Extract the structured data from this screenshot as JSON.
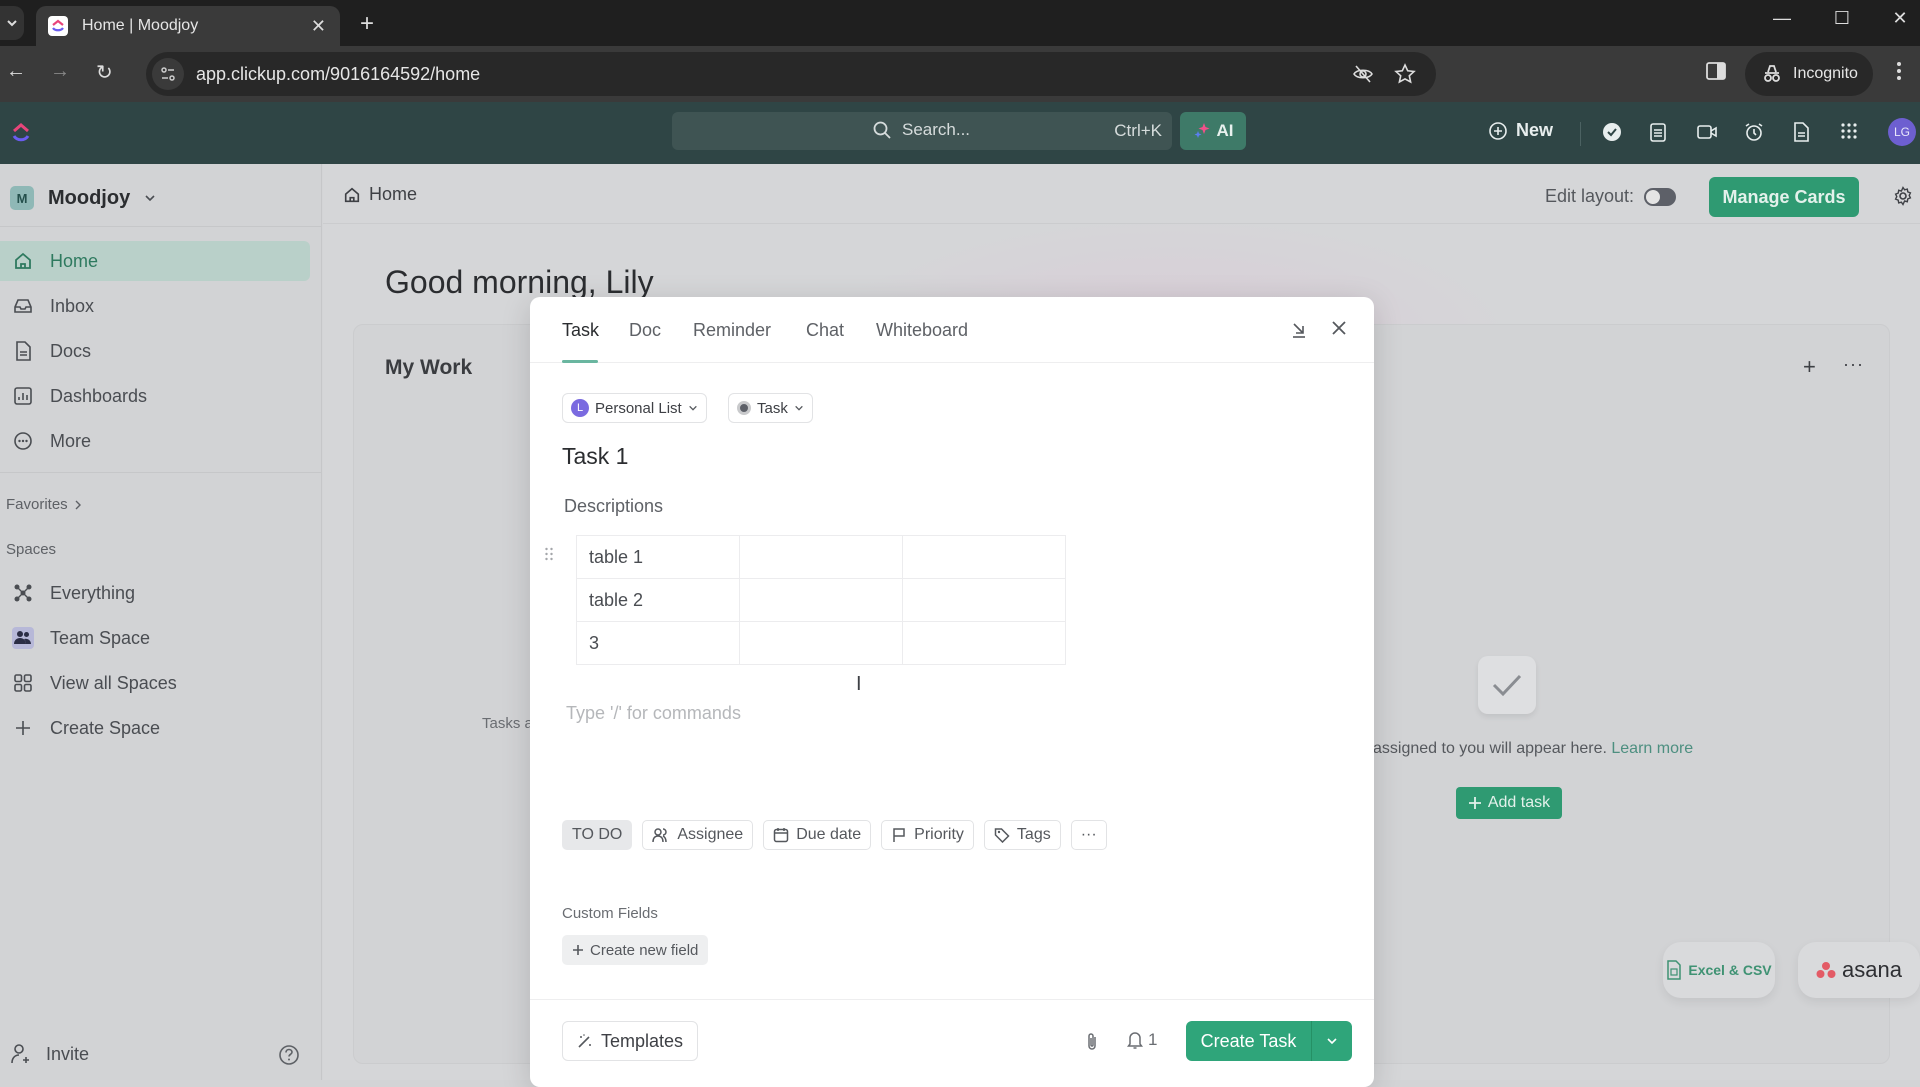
{
  "browser": {
    "tab_title": "Home | Moodjoy",
    "url": "app.clickup.com/9016164592/home",
    "incognito_label": "Incognito"
  },
  "appbar": {
    "search_placeholder": "Search...",
    "search_shortcut": "Ctrl+K",
    "ai_label": "AI",
    "new_label": "New",
    "avatar_initials": "LG"
  },
  "sidebar": {
    "workspace_initial": "M",
    "workspace_name": "Moodjoy",
    "nav": [
      {
        "label": "Home",
        "icon": "home-icon",
        "active": true
      },
      {
        "label": "Inbox",
        "icon": "inbox-icon"
      },
      {
        "label": "Docs",
        "icon": "docs-icon"
      },
      {
        "label": "Dashboards",
        "icon": "dashboards-icon"
      },
      {
        "label": "More",
        "icon": "more-icon"
      }
    ],
    "favorites_label": "Favorites",
    "spaces_label": "Spaces",
    "spaces": [
      {
        "label": "Everything",
        "icon": "everything-icon"
      },
      {
        "label": "Team Space",
        "icon": "team-space-icon"
      },
      {
        "label": "View all Spaces",
        "icon": "grid-icon"
      },
      {
        "label": "Create Space",
        "icon": "plus-icon"
      }
    ],
    "invite_label": "Invite"
  },
  "main": {
    "breadcrumb": "Home",
    "edit_layout_label": "Edit layout:",
    "edit_layout_on": false,
    "manage_cards_label": "Manage Cards",
    "greeting": "Good morning, Lily",
    "my_work_title": "My Work",
    "tasks_partial_text": "Tasks a",
    "empty_text": "assigned to you will appear here.",
    "learn_more": "Learn more",
    "add_task_label": "Add task",
    "import_excel_label": "Excel & CSV",
    "import_asana_label": "asana"
  },
  "modal": {
    "tabs": [
      "Task",
      "Doc",
      "Reminder",
      "Chat",
      "Whiteboard"
    ],
    "active_tab": "Task",
    "list_selector": "Personal List",
    "list_initial": "L",
    "type_selector": "Task",
    "task_name": "Task 1",
    "description_label": "Descriptions",
    "table_rows": [
      [
        "table 1",
        "",
        ""
      ],
      [
        "table 2",
        "",
        ""
      ],
      [
        "3",
        "",
        ""
      ]
    ],
    "command_placeholder": "Type '/' for commands",
    "status": "TO DO",
    "properties": [
      "Assignee",
      "Due date",
      "Priority",
      "Tags"
    ],
    "custom_fields_label": "Custom Fields",
    "create_field_label": "Create new field",
    "templates_label": "Templates",
    "watchers_count": "1",
    "create_task_label": "Create Task"
  },
  "colors": {
    "brand_green": "#2f9a72",
    "appbar_bg": "#2f4545",
    "active_nav_bg": "#b9d0c9"
  }
}
